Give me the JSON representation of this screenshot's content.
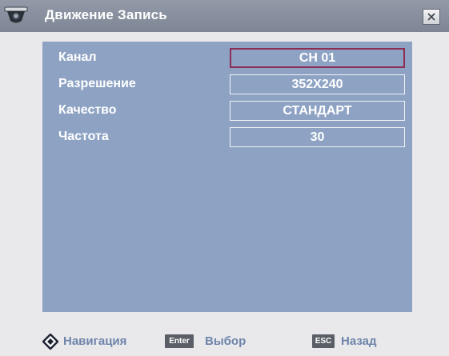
{
  "window": {
    "title": "Движение Запись",
    "close_icon": "close-icon",
    "app_icon": "camera-icon"
  },
  "settings": {
    "rows": [
      {
        "label": "Канал",
        "value": "CH 01",
        "selected": true
      },
      {
        "label": "Разрешение",
        "value": "352X240",
        "selected": false
      },
      {
        "label": "Качество",
        "value": "СТАНДАРТ",
        "selected": false
      },
      {
        "label": "Частота",
        "value": "30",
        "selected": false
      }
    ]
  },
  "footer": {
    "nav_icon": "navigation-diamond-icon",
    "nav_label": "Навигация",
    "enter_key": "Enter",
    "enter_label": "Выбор",
    "esc_key": "ESC",
    "esc_label": "Назад"
  },
  "colors": {
    "panel": "#8ea3c4",
    "titlebar": "#858c9b",
    "selected_border": "#8c2d52",
    "footer_text": "#6e84a9"
  }
}
